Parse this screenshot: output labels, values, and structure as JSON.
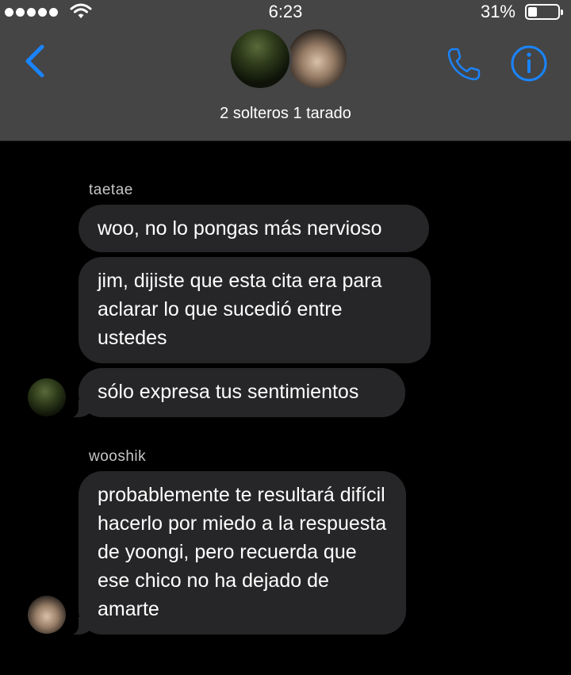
{
  "status_bar": {
    "time": "6:23",
    "battery_text": "31%",
    "battery_level": 0.31
  },
  "header": {
    "group_name": "2 solteros 1 tarado",
    "accent_color": "#1a84ff"
  },
  "messages": [
    {
      "sender": "taetae",
      "bubbles": [
        "woo, no lo pongas más nervioso",
        "jim, dijiste que esta cita era para aclarar lo que sucedió entre ustedes",
        "sólo expresa tus sentimientos"
      ]
    },
    {
      "sender": "wooshik",
      "bubbles": [
        "probablemente te resultará difícil hacerlo por miedo a la respuesta de yoongi, pero recuerda que ese chico no ha dejado de amarte"
      ]
    }
  ]
}
